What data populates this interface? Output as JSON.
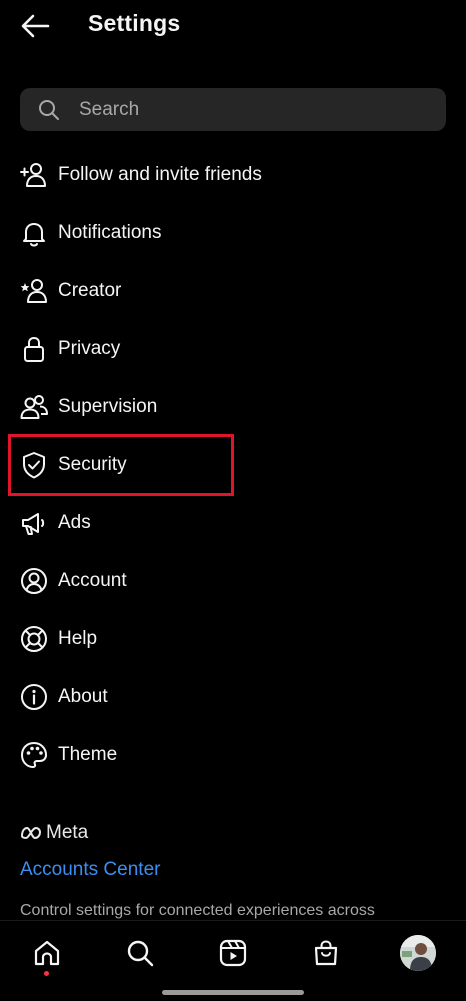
{
  "header": {
    "title": "Settings"
  },
  "search": {
    "placeholder": "Search"
  },
  "menu": {
    "items": [
      {
        "label": "Follow and invite friends",
        "icon": "add-person-icon"
      },
      {
        "label": "Notifications",
        "icon": "bell-icon"
      },
      {
        "label": "Creator",
        "icon": "star-person-icon"
      },
      {
        "label": "Privacy",
        "icon": "lock-icon"
      },
      {
        "label": "Supervision",
        "icon": "people-icon"
      },
      {
        "label": "Security",
        "icon": "shield-check-icon"
      },
      {
        "label": "Ads",
        "icon": "megaphone-icon"
      },
      {
        "label": "Account",
        "icon": "account-circle-icon"
      },
      {
        "label": "Help",
        "icon": "lifebuoy-icon"
      },
      {
        "label": "About",
        "icon": "info-icon"
      },
      {
        "label": "Theme",
        "icon": "palette-icon"
      }
    ]
  },
  "meta": {
    "label": "Meta"
  },
  "accounts_center": {
    "label": "Accounts Center"
  },
  "footer": {
    "text": "Control settings for connected experiences across"
  },
  "bottom_nav": {
    "items": [
      "home-icon",
      "search-icon",
      "reels-icon",
      "shop-icon",
      "profile-avatar"
    ]
  },
  "colors": {
    "background": "#000000",
    "link": "#3d8ef0",
    "highlight": "#e0142b",
    "search_bg": "#262626"
  }
}
